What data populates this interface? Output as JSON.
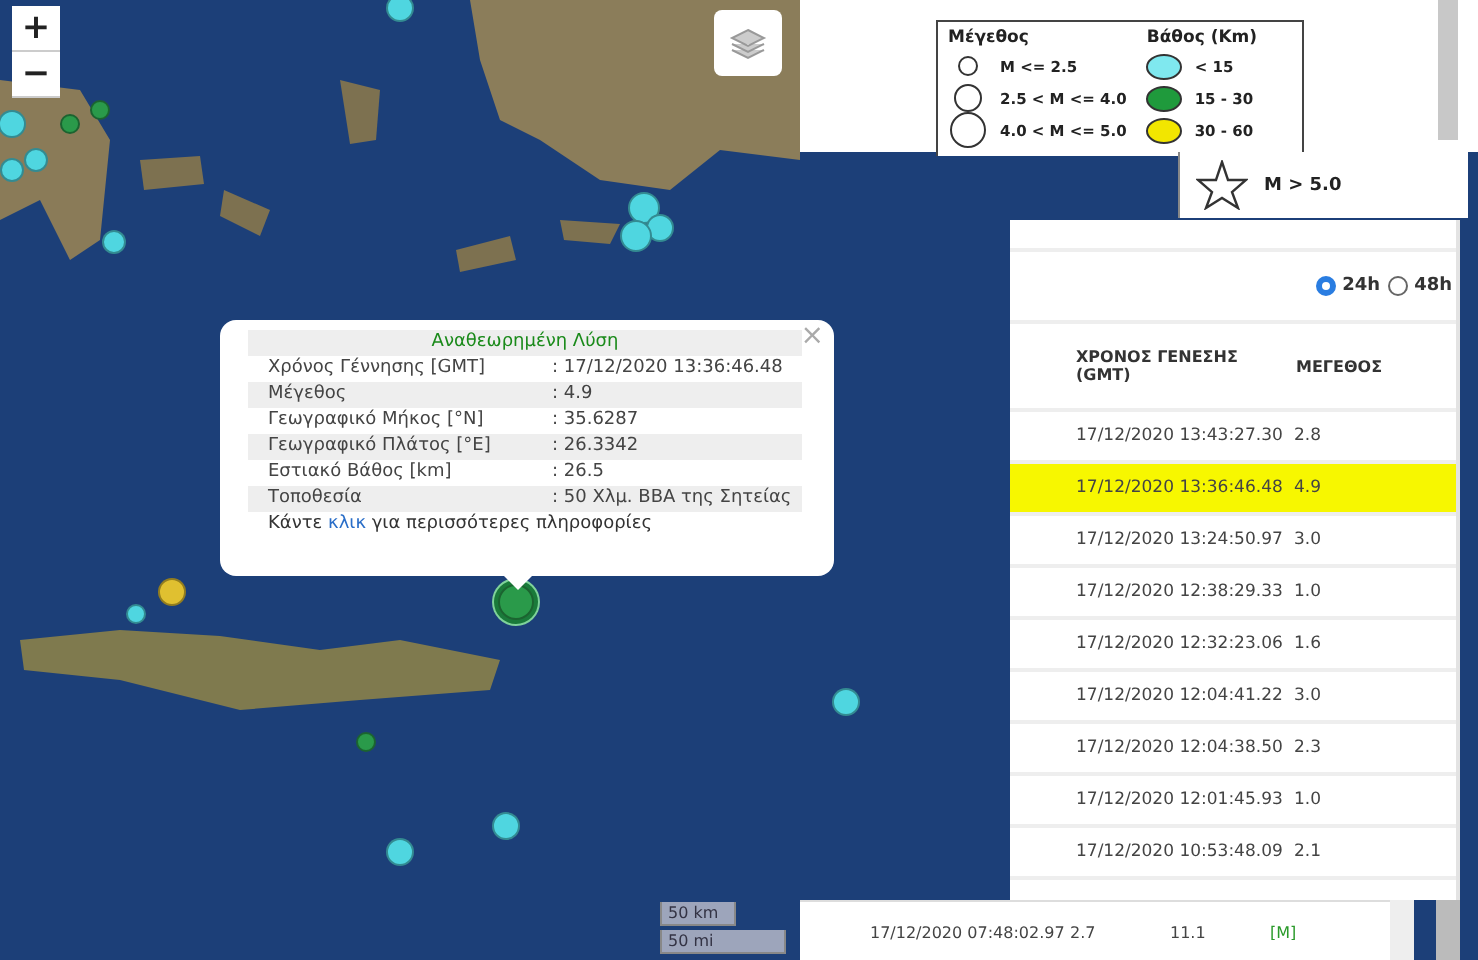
{
  "map": {
    "zoom_in": "+",
    "zoom_out": "−",
    "scale": [
      "50 km",
      "50 mi"
    ],
    "markers": [
      {
        "color": "#4fd6e0",
        "selected": false
      },
      {
        "color": "#4fd6e0",
        "selected": false
      },
      {
        "color": "#4fd6e0",
        "selected": false
      },
      {
        "color": "#2a9a4a",
        "selected": false
      },
      {
        "color": "#2a9a4a",
        "selected": false
      },
      {
        "color": "#4fd6e0",
        "selected": false
      },
      {
        "color": "#4fd6e0",
        "selected": false
      },
      {
        "color": "#4fd6e0",
        "selected": false
      },
      {
        "color": "#4fd6e0",
        "selected": false
      },
      {
        "color": "#4fd6e0",
        "selected": false
      },
      {
        "color": "#e0c030",
        "selected": false
      },
      {
        "color": "#4fd6e0",
        "selected": false
      },
      {
        "color": "#2a9a4a",
        "selected": true
      },
      {
        "color": "#2a9a4a",
        "selected": false
      },
      {
        "color": "#4fd6e0",
        "selected": false
      },
      {
        "color": "#4fd6e0",
        "selected": false
      },
      {
        "color": "#4fd6e0",
        "selected": false
      }
    ]
  },
  "popup": {
    "close": "×",
    "title": "Αναθεωρημένη Λύση",
    "fields": [
      {
        "label": "Χρόνος Γέννησης [GMT]",
        "value": ": 17/12/2020 13:36:46.48"
      },
      {
        "label": "Μέγεθος",
        "value": ": 4.9"
      },
      {
        "label": "Γεωγραφικό Μήκος [°N]",
        "value": ": 35.6287"
      },
      {
        "label": "Γεωγραφικό Πλάτος [°E]",
        "value": ": 26.3342"
      },
      {
        "label": "Εστιακό Βάθος [km]",
        "value": ": 26.5"
      },
      {
        "label": "Τοποθεσία",
        "value": ": 50 Χλμ. ΒΒΑ της Σητείας"
      }
    ],
    "more_info": {
      "before": "Κάντε ",
      "link": "κλικ",
      "after": " για περισσότερες πληροφορίες"
    }
  },
  "legend": {
    "magnitude_title": "Μέγεθος",
    "magnitude": [
      {
        "label": "M <= 2.5"
      },
      {
        "label": "2.5 < M <= 4.0"
      },
      {
        "label": "4.0 < M <= 5.0"
      }
    ],
    "depth_title": "Βάθος (Km)",
    "depth": [
      {
        "label": "< 15",
        "color": "#7fe8ef"
      },
      {
        "label": "15 - 30",
        "color": "#1f9a3c"
      },
      {
        "label": "30 - 60",
        "color": "#f2e600"
      }
    ],
    "star": "M > 5.0"
  },
  "period": [
    {
      "label": "24h",
      "selected": true
    },
    {
      "label": "48h",
      "selected": false
    }
  ],
  "table": {
    "columns": [
      "ΧΡΟΝΟΣ ΓΕΝΕΣΗΣ (GMT)",
      "ΜΕΓΕΘΟΣ"
    ],
    "rows": [
      {
        "time": "17/12/2020 13:43:27.30",
        "magnitude": "2.8",
        "selected": false
      },
      {
        "time": "17/12/2020 13:36:46.48",
        "magnitude": "4.9",
        "selected": true
      },
      {
        "time": "17/12/2020 13:24:50.97",
        "magnitude": "3.0",
        "selected": false
      },
      {
        "time": "17/12/2020 12:38:29.33",
        "magnitude": "1.0",
        "selected": false
      },
      {
        "time": "17/12/2020 12:32:23.06",
        "magnitude": "1.6",
        "selected": false
      },
      {
        "time": "17/12/2020 12:04:41.22",
        "magnitude": "3.0",
        "selected": false
      },
      {
        "time": "17/12/2020 12:04:38.50",
        "magnitude": "2.3",
        "selected": false
      },
      {
        "time": "17/12/2020 12:01:45.93",
        "magnitude": "1.0",
        "selected": false
      },
      {
        "time": "17/12/2020 10:53:48.09",
        "magnitude": "2.1",
        "selected": false
      }
    ]
  },
  "bottom_row": [
    "17/12/2020 07:48:02.97",
    "2.7",
    "11.1",
    "[M]"
  ]
}
